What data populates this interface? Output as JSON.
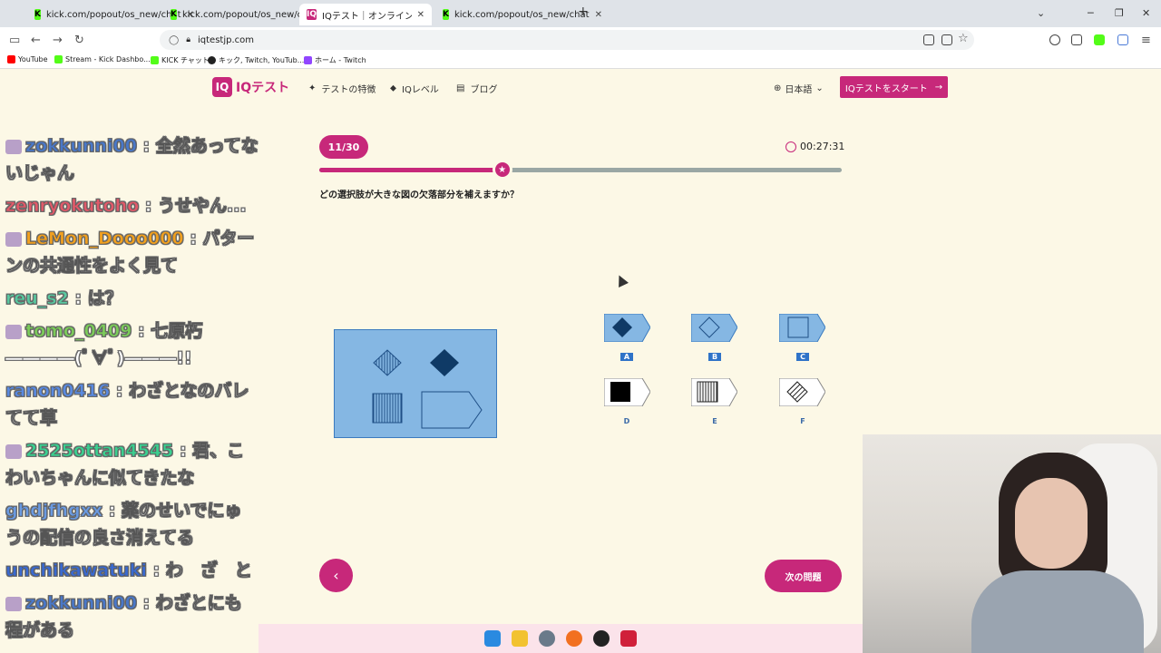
{
  "browser": {
    "tabs": [
      {
        "label": "kick.com/popout/os_new/chat",
        "favicon": "K"
      },
      {
        "label": "kick.com/popout/os_new/chat",
        "favicon": "K"
      },
      {
        "label": "IQテスト｜オンラインIQ診断・知能",
        "favicon": "IQ"
      },
      {
        "label": "kick.com/popout/os_new/chat",
        "favicon": "K"
      }
    ],
    "new_tab": "+",
    "url": "iqtestjp.com",
    "bookmarks": [
      "YouTube",
      "Stream - Kick Dashbo...",
      "KICK チャット",
      "キック, Twitch, YouTub...",
      "ホーム - Twitch"
    ]
  },
  "site": {
    "logo_badge": "IQ",
    "logo_text": "IQテスト",
    "menu": [
      "テストの特徴",
      "IQレベル",
      "ブログ"
    ],
    "language": "日本語",
    "start_button": "IQテストをスタート"
  },
  "quiz": {
    "counter": "11/30",
    "timer": "00:27:31",
    "progress": 0.35,
    "question": "どの選択肢が大きな図の欠落部分を補えますか？",
    "options": [
      {
        "label": "A",
        "selected": true
      },
      {
        "label": "B",
        "selected": true
      },
      {
        "label": "C",
        "selected": true
      },
      {
        "label": "D",
        "selected": false
      },
      {
        "label": "E",
        "selected": false
      },
      {
        "label": "F",
        "selected": false
      }
    ],
    "prev_button": "‹",
    "next_button": "次の問題"
  },
  "chat": [
    {
      "user": "zokkunni00",
      "message": "全然あってないじゃん",
      "color": "#4a78c8",
      "badge": true
    },
    {
      "user": "zenryokutoho",
      "message": "うせやん...",
      "color": "#e05a6a",
      "badge": false
    },
    {
      "user": "LeMon_Dooo000",
      "message": "パターンの共通性をよく見て",
      "color": "#f0a020",
      "badge": true
    },
    {
      "user": "reu_s2",
      "message": "は？",
      "color": "#5ac8a0",
      "badge": false
    },
    {
      "user": "tomo_0409",
      "message": "七原朽 ――――(ﾟ∀ﾟ)―――!!",
      "color": "#7ccc5a",
      "badge": true
    },
    {
      "user": "ranon0416",
      "message": "わざとなのバレてて草",
      "color": "#5a8ae0",
      "badge": false
    },
    {
      "user": "2525ottan4545",
      "message": "君、こわいちゃんに似てきたな",
      "color": "#3ccf90",
      "badge": true
    },
    {
      "user": "ghdjfhgxx",
      "message": "薬のせいでにゅうの配信の良さ消えてる",
      "color": "#6a9ae0",
      "badge": false
    },
    {
      "user": "unchikawatuki",
      "message": "わ　ざ　と",
      "color": "#3a6ad0",
      "badge": false
    },
    {
      "user": "zokkunni00",
      "message": "わざとにも程がある",
      "color": "#4a78c8",
      "badge": true
    }
  ],
  "colors": {
    "accent": "#c7287a",
    "page_bg": "#fcf8e6",
    "figure_blue": "#85b7e3",
    "figure_dark": "#0f3a66"
  }
}
